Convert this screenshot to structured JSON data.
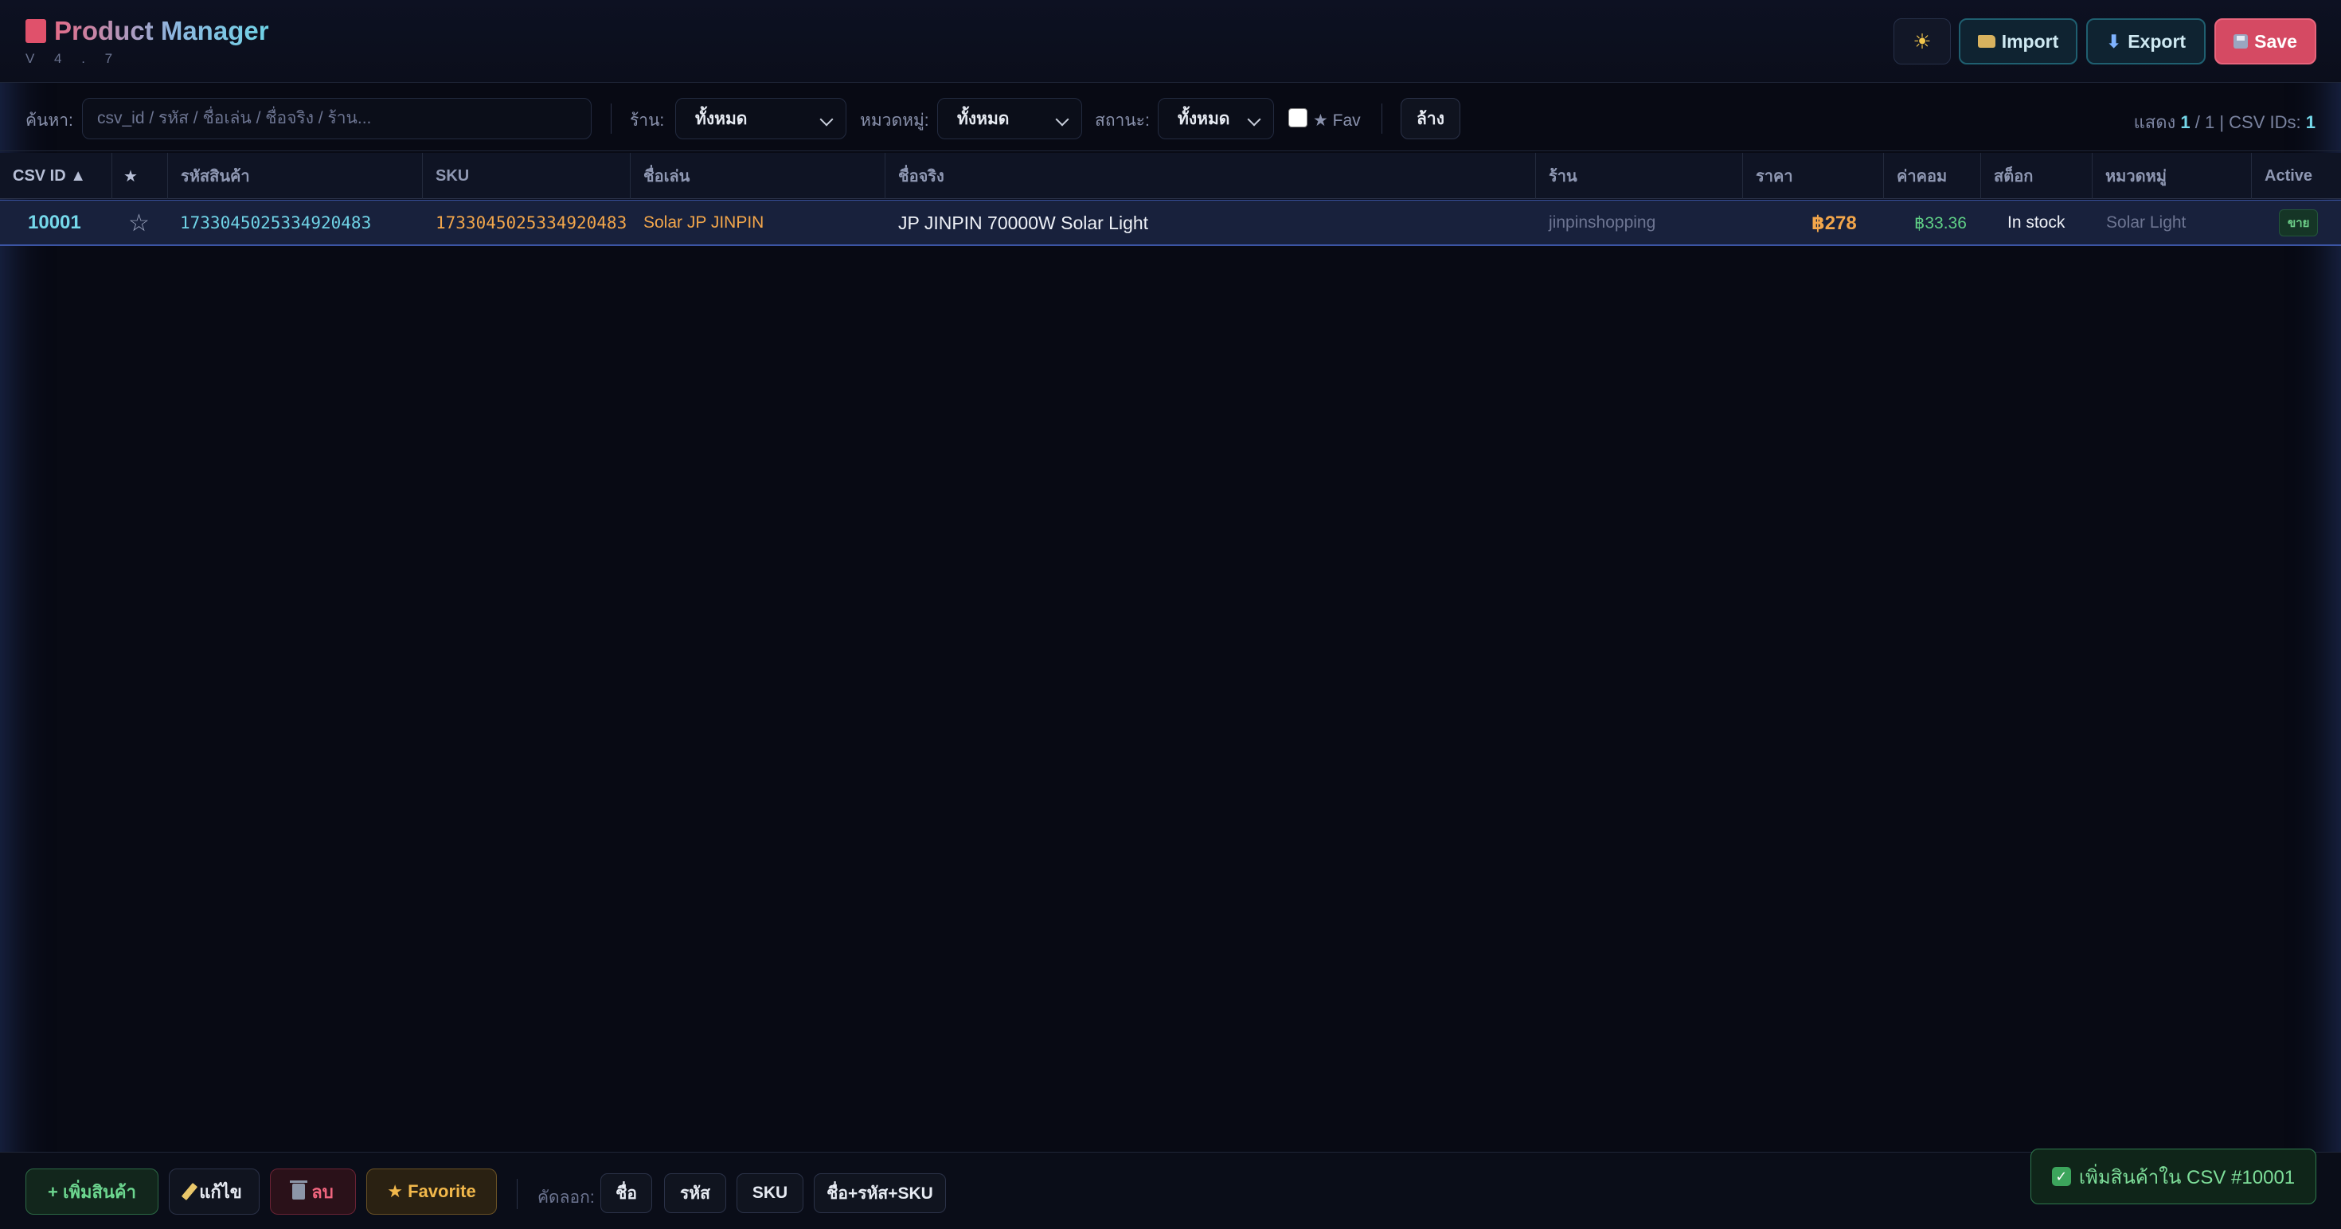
{
  "app": {
    "title": "Product Manager",
    "version": "V 4 . 7"
  },
  "header": {
    "theme_icon": "sun-icon",
    "import_label": "Import",
    "export_label": "Export",
    "save_label": "Save"
  },
  "filters": {
    "search_label": "ค้นหา:",
    "search_placeholder": "csv_id / รหัส / ชื่อเล่น / ชื่อจริง / ร้าน...",
    "shop_label": "ร้าน:",
    "shop_value": "ทั้งหมด",
    "category_label": "หมวดหมู่:",
    "category_value": "ทั้งหมด",
    "status_label": "สถานะ:",
    "status_value": "ทั้งหมด",
    "fav_label": "★ Fav",
    "clear_label": "ล้าง",
    "count_prefix": "แสดง",
    "count_shown": "1",
    "count_total": "/ 1 | CSV IDs:",
    "count_ids": "1"
  },
  "table": {
    "columns": [
      "CSV ID ▲",
      "★",
      "รหัสสินค้า",
      "SKU",
      "ชื่อเล่น",
      "ชื่อจริง",
      "ร้าน",
      "ราคา",
      "ค่าคอม",
      "สต็อก",
      "หมวดหมู่",
      "Active"
    ],
    "rows": [
      {
        "csv_id": "10001",
        "fav": "☆",
        "code": "1733045025334920483",
        "sku": "1733045025334920483",
        "nickname": "Solar JP JINPIN",
        "name": "JP JINPIN 70000W Solar Light",
        "shop": "jinpinshopping",
        "price": "฿278",
        "commission": "฿33.36",
        "stock": "In stock",
        "category": "Solar Light",
        "active": "ขาย"
      }
    ]
  },
  "footer": {
    "add_label": "+ เพิ่มสินค้า",
    "edit_label": "แก้ไข",
    "delete_label": "ลบ",
    "favorite_label": "★ Favorite",
    "copy_label": "คัดลอก:",
    "copy_name": "ชื่อ",
    "copy_code": "รหัส",
    "copy_sku": "SKU",
    "copy_all": "ชื่อ+รหัส+SKU"
  },
  "toast": {
    "message": "เพิ่มสินค้าใน CSV #10001"
  },
  "colors": {
    "accent": "#75d8ea",
    "danger": "#d54a63",
    "success": "#6cd68f",
    "warning": "#f2b84b",
    "row_highlight": "#18213c"
  }
}
